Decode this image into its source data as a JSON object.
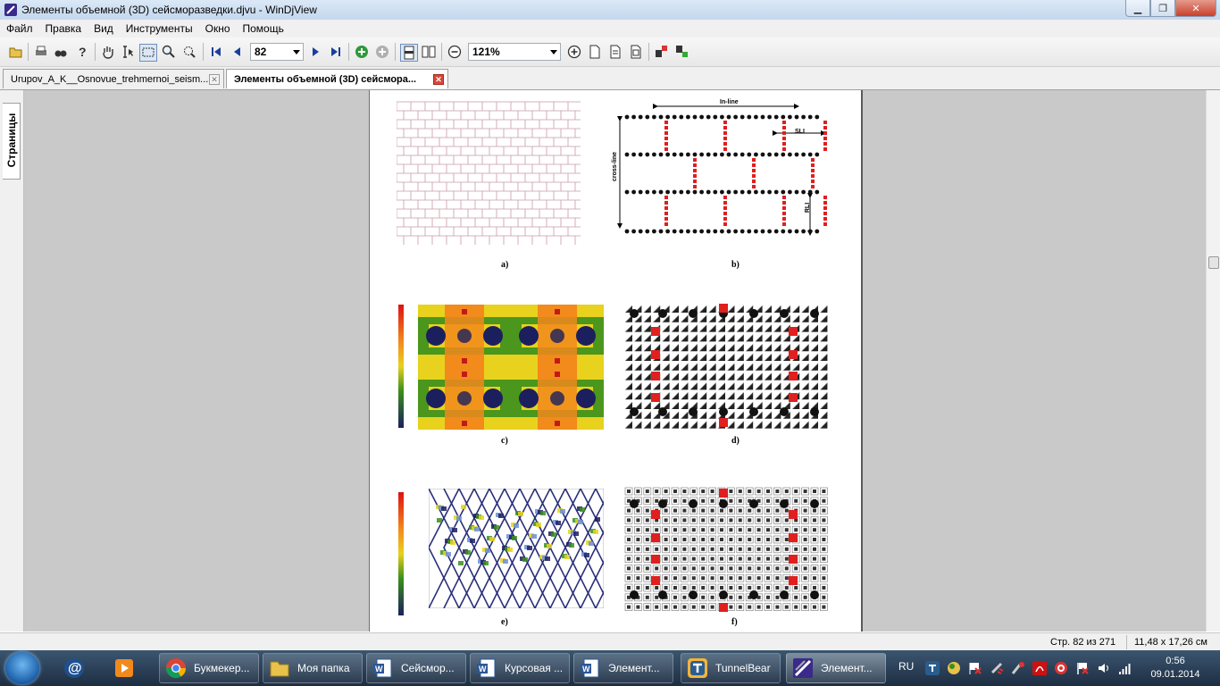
{
  "window": {
    "title": "Элементы объемной (3D) сейсморазведки.djvu - WinDjView"
  },
  "menu": [
    "Файл",
    "Правка",
    "Вид",
    "Инструменты",
    "Окно",
    "Помощь"
  ],
  "toolbar": {
    "page_number": "82",
    "zoom": "121%"
  },
  "tabs": [
    {
      "label": "Urupov_A_K__Osnovue_trehmernoi_seism..."
    },
    {
      "label": "Элементы объемной (3D) сейсмора..."
    }
  ],
  "sidebar": {
    "tab_label": "Страницы"
  },
  "document": {
    "panel_a": {
      "caption": "a)"
    },
    "panel_b": {
      "caption": "b)",
      "label_inline": "In-line",
      "label_crossline": "cross-line",
      "label_rl": "RLI",
      "label_sl": "SLI"
    },
    "panel_c": {
      "caption": "c)"
    },
    "panel_d": {
      "caption": "d)"
    },
    "panel_e": {
      "caption": "e)"
    },
    "panel_f": {
      "caption": "f)"
    }
  },
  "status": {
    "page_info": "Стр. 82 из 271",
    "page_size": "11,48 x 17,26 см"
  },
  "taskbar": {
    "items": [
      {
        "label": "Букмекер...",
        "icon": "chrome-icon"
      },
      {
        "label": "Моя папка",
        "icon": "folder-icon"
      },
      {
        "label": "Сейсмор...",
        "icon": "word-icon"
      },
      {
        "label": "Курсовая ...",
        "icon": "word-icon"
      },
      {
        "label": "Элемент...",
        "icon": "word-icon"
      },
      {
        "label": "TunnelBear",
        "icon": "tunnelbear-icon"
      },
      {
        "label": "Элемент...",
        "icon": "windjview-icon"
      }
    ],
    "language": "RU",
    "time": "0:56",
    "date": "09.01.2014"
  },
  "colors": {
    "accent_red": "#e01f1f",
    "dot_black": "#111111",
    "heat_orange": "#f28a1c",
    "heat_yellow": "#e8d21d",
    "heat_green": "#3a8f1d",
    "heat_navy": "#1c1f5e"
  }
}
